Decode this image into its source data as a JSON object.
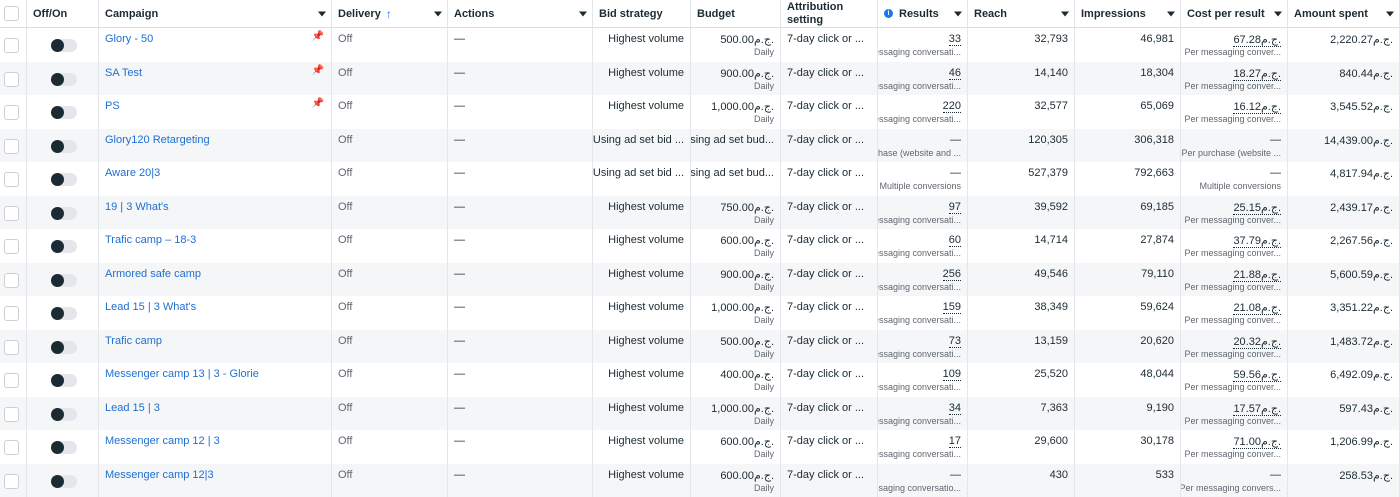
{
  "headers": {
    "off_on": "Off/On",
    "campaign": "Campaign",
    "delivery": "Delivery",
    "actions": "Actions",
    "bid_strategy": "Bid strategy",
    "budget": "Budget",
    "attribution_line1": "Attribution",
    "attribution_line2": "setting",
    "results": "Results",
    "reach": "Reach",
    "impressions": "Impressions",
    "cost_per_result": "Cost per result",
    "amount_spent": "Amount spent"
  },
  "rows": [
    {
      "campaign": "Glory - 50",
      "pinned": true,
      "delivery": "Off",
      "actions": "—",
      "bid": "Highest volume",
      "budget": "500.00ج.م.",
      "budget_sub": "Daily",
      "attribution": "7-day click or ...",
      "results": "33",
      "results_sub": "Messaging conversati...",
      "reach": "32,793",
      "impressions": "46,981",
      "cpr": "67.28ج.م.",
      "cpr_sub": "Per messaging conver...",
      "spent": "2,220.27ج.م."
    },
    {
      "campaign": "SA Test",
      "pinned": true,
      "delivery": "Off",
      "actions": "—",
      "bid": "Highest volume",
      "budget": "900.00ج.م.",
      "budget_sub": "Daily",
      "attribution": "7-day click or ...",
      "results": "46",
      "results_sub": "Messaging conversati...",
      "reach": "14,140",
      "impressions": "18,304",
      "cpr": "18.27ج.م.",
      "cpr_sub": "Per messaging conver...",
      "spent": "840.44ج.م."
    },
    {
      "campaign": "PS",
      "pinned": true,
      "delivery": "Off",
      "actions": "—",
      "bid": "Highest volume",
      "budget": "1,000.00ج.م.",
      "budget_sub": "Daily",
      "attribution": "7-day click or ...",
      "results": "220",
      "results_sub": "Messaging conversati...",
      "reach": "32,577",
      "impressions": "65,069",
      "cpr": "16.12ج.م.",
      "cpr_sub": "Per messaging conver...",
      "spent": "3,545.52ج.م."
    },
    {
      "campaign": "Glory120 Retargeting",
      "pinned": false,
      "delivery": "Off",
      "actions": "—",
      "bid": "Using ad set bid ...",
      "budget": "Using ad set bud...",
      "budget_sub": "",
      "attribution": "7-day click or ...",
      "results": "—",
      "results_sub": "Purchase (website and ...",
      "reach": "120,305",
      "impressions": "306,318",
      "cpr": "—",
      "cpr_sub": "Per purchase (website ...",
      "spent": "14,439.00ج.م."
    },
    {
      "campaign": "Aware 20|3",
      "pinned": false,
      "delivery": "Off",
      "actions": "—",
      "bid": "Using ad set bid ...",
      "budget": "Using ad set bud...",
      "budget_sub": "",
      "attribution": "7-day click or ...",
      "results": "—",
      "results_sub": "Multiple conversions",
      "reach": "527,379",
      "impressions": "792,663",
      "cpr": "—",
      "cpr_sub": "Multiple conversions",
      "spent": "4,817.94ج.م."
    },
    {
      "campaign": "19 | 3 What's",
      "pinned": false,
      "delivery": "Off",
      "actions": "—",
      "bid": "Highest volume",
      "budget": "750.00ج.م.",
      "budget_sub": "Daily",
      "attribution": "7-day click or ...",
      "results": "97",
      "results_sub": "Messaging conversati...",
      "reach": "39,592",
      "impressions": "69,185",
      "cpr": "25.15ج.م.",
      "cpr_sub": "Per messaging conver...",
      "spent": "2,439.17ج.م."
    },
    {
      "campaign": "Trafic camp – 18-3",
      "pinned": false,
      "delivery": "Off",
      "actions": "—",
      "bid": "Highest volume",
      "budget": "600.00ج.م.",
      "budget_sub": "Daily",
      "attribution": "7-day click or ...",
      "results": "60",
      "results_sub": "Messaging conversati...",
      "reach": "14,714",
      "impressions": "27,874",
      "cpr": "37.79ج.م.",
      "cpr_sub": "Per messaging conver...",
      "spent": "2,267.56ج.م."
    },
    {
      "campaign": "Armored safe camp",
      "pinned": false,
      "delivery": "Off",
      "actions": "—",
      "bid": "Highest volume",
      "budget": "900.00ج.م.",
      "budget_sub": "Daily",
      "attribution": "7-day click or ...",
      "results": "256",
      "results_sub": "Messaging conversati...",
      "reach": "49,546",
      "impressions": "79,110",
      "cpr": "21.88ج.م.",
      "cpr_sub": "Per messaging conver...",
      "spent": "5,600.59ج.م."
    },
    {
      "campaign": "Lead 15 | 3 What's",
      "pinned": false,
      "delivery": "Off",
      "actions": "—",
      "bid": "Highest volume",
      "budget": "1,000.00ج.م.",
      "budget_sub": "Daily",
      "attribution": "7-day click or ...",
      "results": "159",
      "results_sub": "Messaging conversati...",
      "reach": "38,349",
      "impressions": "59,624",
      "cpr": "21.08ج.م.",
      "cpr_sub": "Per messaging conver...",
      "spent": "3,351.22ج.م."
    },
    {
      "campaign": "Trafic camp",
      "pinned": false,
      "delivery": "Off",
      "actions": "—",
      "bid": "Highest volume",
      "budget": "500.00ج.م.",
      "budget_sub": "Daily",
      "attribution": "7-day click or ...",
      "results": "73",
      "results_sub": "Messaging conversati...",
      "reach": "13,159",
      "impressions": "20,620",
      "cpr": "20.32ج.م.",
      "cpr_sub": "Per messaging conver...",
      "spent": "1,483.72ج.م."
    },
    {
      "campaign": "Messenger camp 13 | 3 - Glorie",
      "pinned": false,
      "delivery": "Off",
      "actions": "—",
      "bid": "Highest volume",
      "budget": "400.00ج.م.",
      "budget_sub": "Daily",
      "attribution": "7-day click or ...",
      "results": "109",
      "results_sub": "Messaging conversati...",
      "reach": "25,520",
      "impressions": "48,044",
      "cpr": "59.56ج.م.",
      "cpr_sub": "Per messaging conver...",
      "spent": "6,492.09ج.م."
    },
    {
      "campaign": "Lead 15 | 3",
      "pinned": false,
      "delivery": "Off",
      "actions": "—",
      "bid": "Highest volume",
      "budget": "1,000.00ج.م.",
      "budget_sub": "Daily",
      "attribution": "7-day click or ...",
      "results": "34",
      "results_sub": "Messaging conversati...",
      "reach": "7,363",
      "impressions": "9,190",
      "cpr": "17.57ج.م.",
      "cpr_sub": "Per messaging conver...",
      "spent": "597.43ج.م."
    },
    {
      "campaign": "Messenger camp 12 | 3",
      "pinned": false,
      "delivery": "Off",
      "actions": "—",
      "bid": "Highest volume",
      "budget": "600.00ج.م.",
      "budget_sub": "Daily",
      "attribution": "7-day click or ...",
      "results": "17",
      "results_sub": "Messaging conversati...",
      "reach": "29,600",
      "impressions": "30,178",
      "cpr": "71.00ج.م.",
      "cpr_sub": "Per messaging conver...",
      "spent": "1,206.99ج.م."
    },
    {
      "campaign": "Messenger camp 12|3",
      "pinned": false,
      "delivery": "Off",
      "actions": "—",
      "bid": "Highest volume",
      "budget": "600.00ج.م.",
      "budget_sub": "Daily",
      "attribution": "7-day click or ...",
      "results": "—",
      "results_sub": "Messaging conversatio...",
      "reach": "430",
      "impressions": "533",
      "cpr": "—",
      "cpr_sub": "Per messaging convers...",
      "spent": "258.53ج.م."
    }
  ],
  "colors": {
    "link": "#1f6fd1",
    "accent": "#1877f2",
    "row_alt": "#f5f6f7",
    "toggle_knob": "#1c2b33"
  }
}
